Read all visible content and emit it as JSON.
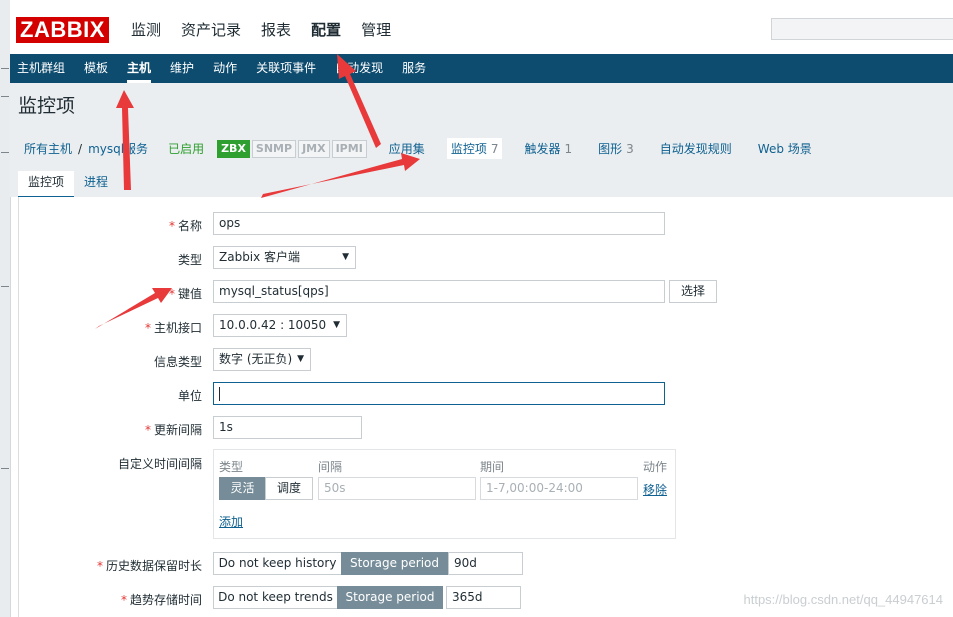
{
  "topbar": {
    "logo": "ZABBIX",
    "menu": [
      "监测",
      "资产记录",
      "报表",
      "配置",
      "管理"
    ],
    "active_menu": "配置",
    "search_icon": "search-icon"
  },
  "submenu": {
    "items": [
      "主机群组",
      "模板",
      "主机",
      "维护",
      "动作",
      "关联项事件",
      "自动发现",
      "服务"
    ],
    "active": "主机"
  },
  "page": {
    "title": "监控项"
  },
  "hostnav": {
    "all_hosts": "所有主机",
    "separator": "/",
    "host": "mysql服务",
    "status": "已启用",
    "badges": [
      {
        "label": "ZBX",
        "active": true
      },
      {
        "label": "SNMP",
        "active": false
      },
      {
        "label": "JMX",
        "active": false
      },
      {
        "label": "IPMI",
        "active": false
      }
    ],
    "tabs": [
      {
        "label": "应用集",
        "count": ""
      },
      {
        "label": "监控项",
        "count": "7"
      },
      {
        "label": "触发器",
        "count": "1"
      },
      {
        "label": "图形",
        "count": "3"
      },
      {
        "label": "自动发现规则",
        "count": ""
      },
      {
        "label": "Web 场景",
        "count": ""
      }
    ]
  },
  "form_tabs": [
    "监控项",
    "进程"
  ],
  "form": {
    "name": {
      "label": "名称",
      "value": "ops"
    },
    "type": {
      "label": "类型",
      "value": "Zabbix 客户端"
    },
    "key": {
      "label": "键值",
      "value": "mysql_status[qps]",
      "select_button": "选择"
    },
    "interface": {
      "label": "主机接口",
      "value": "10.0.0.42 : 10050"
    },
    "info_type": {
      "label": "信息类型",
      "value": "数字 (无正负)"
    },
    "units": {
      "label": "单位",
      "value": ""
    },
    "update_interval": {
      "label": "更新间隔",
      "value": "1s"
    },
    "custom_intervals": {
      "label": "自定义时间间隔",
      "headers": {
        "type": "类型",
        "interval": "间隔",
        "period": "期间",
        "action": "动作"
      },
      "type_options": [
        "灵活",
        "调度"
      ],
      "interval_placeholder": "50s",
      "period_placeholder": "1-7,00:00-24:00",
      "remove": "移除",
      "add": "添加"
    },
    "history": {
      "label": "历史数据保留时长",
      "options": [
        "Do not keep history",
        "Storage period"
      ],
      "value": "90d"
    },
    "trends": {
      "label": "趋势存储时间",
      "options": [
        "Do not keep trends",
        "Storage period"
      ],
      "value": "365d"
    }
  },
  "watermark": "https://blog.csdn.net/qq_44947614"
}
